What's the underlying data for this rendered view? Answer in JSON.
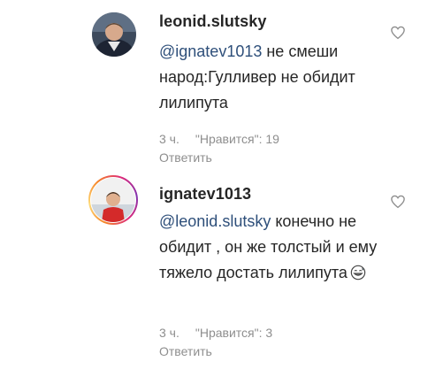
{
  "comments": [
    {
      "username": "leonid.slutsky",
      "mention": "@ignatev1013",
      "text": " не смеши народ:Гулливер не обидит лилипута",
      "time": "3 ч.",
      "likes": "\"Нравится\": 19",
      "reply": "Ответить"
    },
    {
      "username": "ignatev1013",
      "mention": "@leonid.slutsky",
      "text": " конечно не обидит , он же толстый и ему тяжело достать лилипута",
      "emoji": "grinning-sweat-emoji",
      "time": "3 ч.",
      "likes": "\"Нравится\": 3",
      "reply": "Ответить"
    }
  ],
  "icons": {
    "like": "heart-outline-icon"
  },
  "colors": {
    "mention": "#2e4f7a",
    "meta": "#8e8e8e",
    "story_ring": [
      "#f58529",
      "#dd2a7b",
      "#8134af"
    ]
  }
}
